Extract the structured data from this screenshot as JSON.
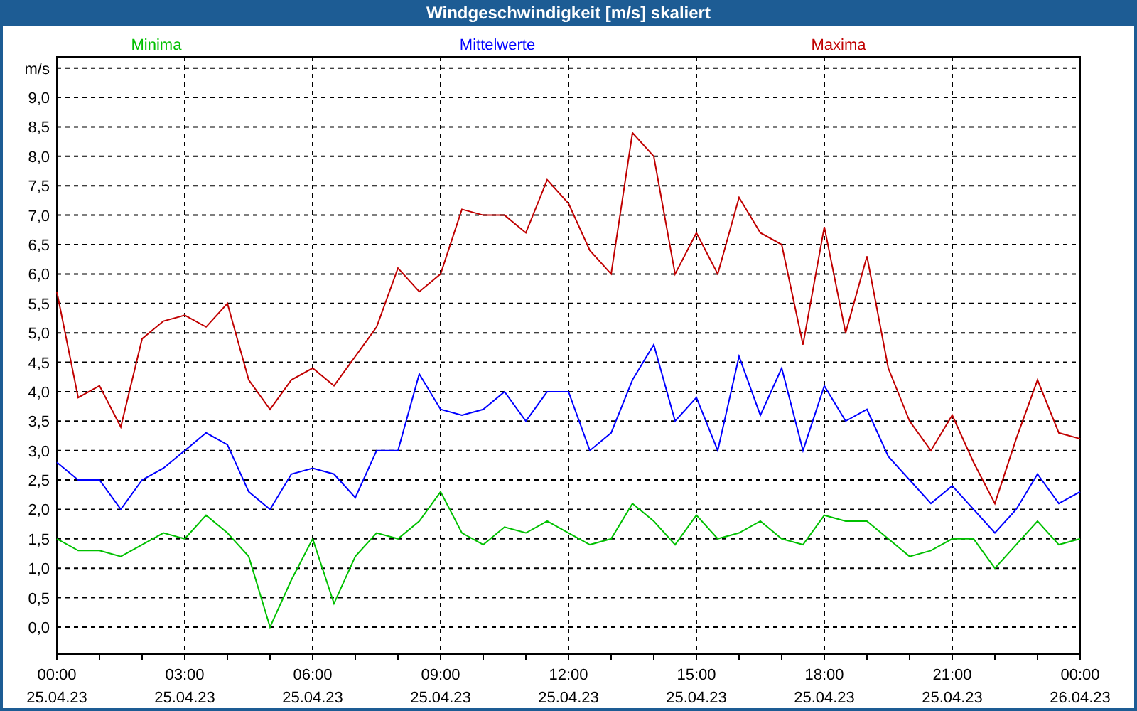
{
  "window": {
    "title": "Windgeschwindigkeit [m/s] skaliert"
  },
  "chart": {
    "chart_data": {
      "type": "line",
      "ylabel": "m/s",
      "categories": [
        "00:00\n25.04.23",
        null,
        null,
        null,
        null,
        null,
        "03:00\n25.04.23",
        null,
        null,
        null,
        null,
        null,
        "06:00\n25.04.23",
        null,
        null,
        null,
        null,
        null,
        "09:00\n25.04.23",
        null,
        null,
        null,
        null,
        null,
        "12:00\n25.04.23",
        null,
        null,
        null,
        null,
        null,
        "15:00\n25.04.23",
        null,
        null,
        null,
        null,
        null,
        "18:00\n25.04.23",
        null,
        null,
        null,
        null,
        null,
        "21:00\n25.04.23",
        null,
        null,
        null,
        null,
        null,
        "00:00\n26.04.23"
      ],
      "series": [
        {
          "name": "Minima",
          "color": "#00c000",
          "values": [
            1.5,
            1.3,
            1.3,
            1.2,
            1.4,
            1.6,
            1.5,
            1.9,
            1.6,
            1.2,
            0.0,
            0.8,
            1.5,
            0.4,
            1.2,
            1.6,
            1.5,
            1.8,
            2.3,
            1.6,
            1.4,
            1.7,
            1.6,
            1.8,
            1.6,
            1.4,
            1.5,
            2.1,
            1.8,
            1.4,
            1.9,
            1.5,
            1.6,
            1.8,
            1.5,
            1.4,
            1.9,
            1.8,
            1.8,
            1.5,
            1.2,
            1.3,
            1.5,
            1.5,
            1.0,
            1.4,
            1.8,
            1.4,
            1.5
          ]
        },
        {
          "name": "Mittelwerte",
          "color": "#0000ff",
          "values": [
            2.8,
            2.5,
            2.5,
            2.0,
            2.5,
            2.7,
            3.0,
            3.3,
            3.1,
            2.3,
            2.0,
            2.6,
            2.7,
            2.6,
            2.2,
            3.0,
            3.0,
            4.3,
            3.7,
            3.6,
            3.7,
            4.0,
            3.5,
            4.0,
            4.0,
            3.0,
            3.3,
            4.2,
            4.8,
            3.5,
            3.9,
            3.0,
            4.6,
            3.6,
            4.4,
            3.0,
            4.1,
            3.5,
            3.7,
            2.9,
            2.5,
            2.1,
            2.4,
            2.0,
            1.6,
            2.0,
            2.6,
            2.1,
            2.3
          ]
        },
        {
          "name": "Maxima",
          "color": "#c00000",
          "values": [
            5.7,
            3.9,
            4.1,
            3.4,
            4.9,
            5.2,
            5.3,
            5.1,
            5.5,
            4.2,
            3.7,
            4.2,
            4.4,
            4.1,
            4.6,
            5.1,
            6.1,
            5.7,
            6.0,
            7.1,
            7.0,
            7.0,
            6.7,
            7.6,
            7.2,
            6.4,
            6.0,
            8.4,
            8.0,
            6.0,
            6.7,
            6.0,
            7.3,
            6.7,
            6.5,
            4.8,
            6.8,
            5.0,
            6.3,
            4.4,
            3.5,
            3.0,
            3.6,
            2.8,
            2.1,
            3.2,
            4.2,
            3.3,
            3.2
          ]
        }
      ],
      "ylim": [
        -0.46,
        9.69
      ],
      "grid": true,
      "yticks": [
        {
          "value": 0,
          "label": "0,0"
        },
        {
          "value": 0.5,
          "label": "0,5"
        },
        {
          "value": 1,
          "label": "1,0"
        },
        {
          "value": 1.5,
          "label": "1,5"
        },
        {
          "value": 2,
          "label": "2,0"
        },
        {
          "value": 2.5,
          "label": "2,5"
        },
        {
          "value": 3,
          "label": "3,0"
        },
        {
          "value": 3.5,
          "label": "3,5"
        },
        {
          "value": 4,
          "label": "4,0"
        },
        {
          "value": 4.5,
          "label": "4,5"
        },
        {
          "value": 5,
          "label": "5,0"
        },
        {
          "value": 5.5,
          "label": "5,5"
        },
        {
          "value": 6,
          "label": "6,0"
        },
        {
          "value": 6.5,
          "label": "6,5"
        },
        {
          "value": 7,
          "label": "7,0"
        },
        {
          "value": 7.5,
          "label": "7,5"
        },
        {
          "value": 8,
          "label": "8,0"
        },
        {
          "value": 8.5,
          "label": "8,5"
        },
        {
          "value": 9,
          "label": "9,0"
        }
      ]
    }
  }
}
